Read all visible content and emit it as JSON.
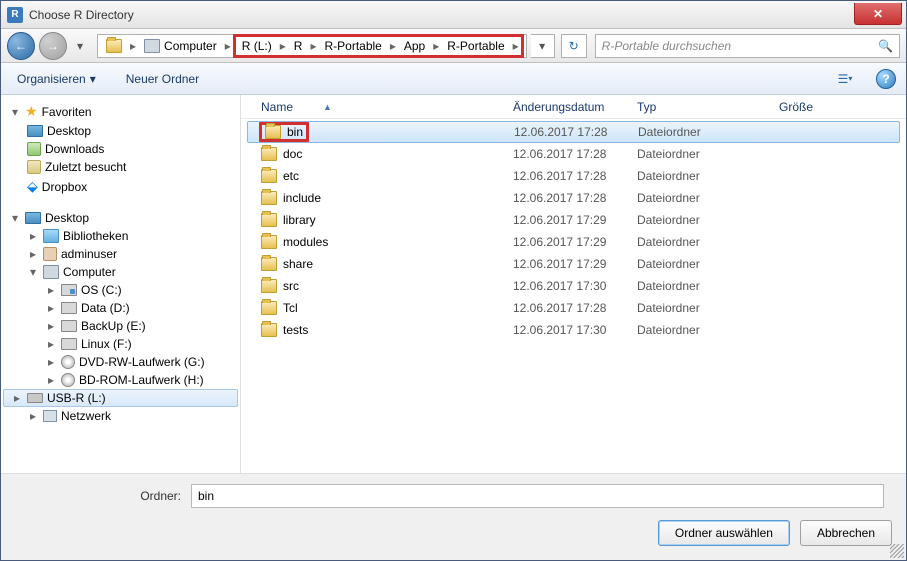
{
  "window": {
    "title": "Choose R Directory"
  },
  "breadcrumb": {
    "before": [
      "Computer"
    ],
    "highlighted": [
      "R (L:)",
      "R",
      "R-Portable",
      "App",
      "R-Portable"
    ]
  },
  "search": {
    "placeholder": "R-Portable durchsuchen"
  },
  "toolbar": {
    "organize": "Organisieren",
    "newfolder": "Neuer Ordner"
  },
  "columns": {
    "name": "Name",
    "date": "Änderungsdatum",
    "type": "Typ",
    "size": "Größe"
  },
  "rows": [
    {
      "name": "bin",
      "date": "12.06.2017 17:28",
      "type": "Dateiordner",
      "selected": true,
      "highlighted": true
    },
    {
      "name": "doc",
      "date": "12.06.2017 17:28",
      "type": "Dateiordner"
    },
    {
      "name": "etc",
      "date": "12.06.2017 17:28",
      "type": "Dateiordner"
    },
    {
      "name": "include",
      "date": "12.06.2017 17:28",
      "type": "Dateiordner"
    },
    {
      "name": "library",
      "date": "12.06.2017 17:29",
      "type": "Dateiordner"
    },
    {
      "name": "modules",
      "date": "12.06.2017 17:29",
      "type": "Dateiordner"
    },
    {
      "name": "share",
      "date": "12.06.2017 17:29",
      "type": "Dateiordner"
    },
    {
      "name": "src",
      "date": "12.06.2017 17:30",
      "type": "Dateiordner"
    },
    {
      "name": "Tcl",
      "date": "12.06.2017 17:28",
      "type": "Dateiordner"
    },
    {
      "name": "tests",
      "date": "12.06.2017 17:30",
      "type": "Dateiordner"
    }
  ],
  "tree": {
    "favorites": "Favoriten",
    "fav_items": [
      "Desktop",
      "Downloads",
      "Zuletzt besucht",
      "Dropbox"
    ],
    "desktop": "Desktop",
    "desktop_items": {
      "lib": "Bibliotheken",
      "user": "adminuser",
      "computer": "Computer",
      "drives": [
        "OS (C:)",
        "Data (D:)",
        "BackUp (E:)",
        "Linux (F:)",
        "DVD-RW-Laufwerk (G:)",
        "BD-ROM-Laufwerk (H:)",
        "USB-R (L:)"
      ],
      "network": "Netzwerk"
    }
  },
  "footer": {
    "folder_label": "Ordner:",
    "folder_value": "bin",
    "select": "Ordner auswählen",
    "cancel": "Abbrechen"
  }
}
